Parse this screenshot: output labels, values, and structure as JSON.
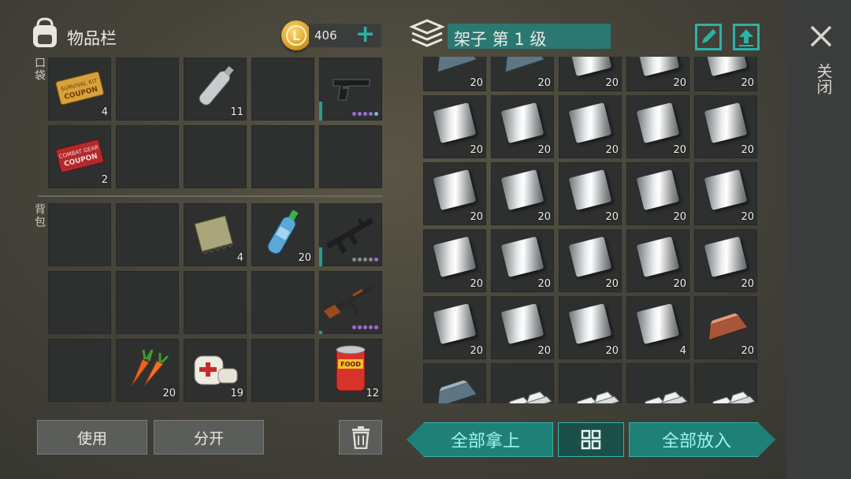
{
  "inventory": {
    "title": "物品栏",
    "coins": "406",
    "add_symbol": "+",
    "pocket_label": "口袋",
    "backpack_label": "背包",
    "pocket": [
      {
        "icon": "coupon-gold-icon",
        "count": "4"
      },
      {
        "icon": "",
        "count": ""
      },
      {
        "icon": "water-bottle-empty-icon",
        "count": "11"
      },
      {
        "icon": "",
        "count": ""
      },
      {
        "icon": "pistol-icon",
        "count": "",
        "weapon": true,
        "dots": [
          "#9b6bd9",
          "#9b6bd9",
          "#9b6bd9",
          "#9b6bd9",
          "#8fb3c9"
        ],
        "bar": 0.3
      },
      {
        "icon": "coupon-red-icon",
        "count": "2"
      },
      {
        "icon": "",
        "count": ""
      },
      {
        "icon": "",
        "count": ""
      },
      {
        "icon": "",
        "count": ""
      },
      {
        "icon": "",
        "count": ""
      }
    ],
    "backpack": [
      {
        "icon": "",
        "count": ""
      },
      {
        "icon": "",
        "count": ""
      },
      {
        "icon": "cloth-icon",
        "count": "4"
      },
      {
        "icon": "water-bottle-icon",
        "count": "20"
      },
      {
        "icon": "m16-rifle-icon",
        "count": "",
        "weapon": true,
        "dots": [
          "#8a8a8a",
          "#8a8a8a",
          "#8a8a8a",
          "#8a8a8a",
          "#9b6bd9"
        ],
        "bar": 0.3
      },
      {
        "icon": "",
        "count": ""
      },
      {
        "icon": "",
        "count": ""
      },
      {
        "icon": "",
        "count": ""
      },
      {
        "icon": "",
        "count": ""
      },
      {
        "icon": "ak47-rifle-icon",
        "count": "",
        "weapon": true,
        "dots": [
          "#9b6bd9",
          "#9b6bd9",
          "#9b6bd9",
          "#9b6bd9",
          "#9b6bd9"
        ],
        "bar": 0.05
      },
      {
        "icon": "",
        "count": ""
      },
      {
        "icon": "carrot-icon",
        "count": "20"
      },
      {
        "icon": "bandage-icon",
        "count": "19"
      },
      {
        "icon": "",
        "count": ""
      },
      {
        "icon": "canned-food-icon",
        "count": "12"
      }
    ],
    "use_button": "使用",
    "split_button": "分开"
  },
  "storage": {
    "title": "架子 第 1 级",
    "rows": [
      [
        {
          "icon": "iron-ingot-icon",
          "count": "20"
        },
        {
          "icon": "iron-ingot-icon",
          "count": "20"
        },
        {
          "icon": "steel-plate-icon",
          "count": "20"
        },
        {
          "icon": "steel-plate-icon",
          "count": "20"
        },
        {
          "icon": "steel-plate-icon",
          "count": "20"
        }
      ],
      [
        {
          "icon": "steel-plate-icon",
          "count": "20"
        },
        {
          "icon": "steel-plate-icon",
          "count": "20"
        },
        {
          "icon": "steel-plate-icon",
          "count": "20"
        },
        {
          "icon": "steel-plate-icon",
          "count": "20"
        },
        {
          "icon": "steel-plate-icon",
          "count": "20"
        }
      ],
      [
        {
          "icon": "steel-plate-icon",
          "count": "20"
        },
        {
          "icon": "steel-plate-icon",
          "count": "20"
        },
        {
          "icon": "steel-plate-icon",
          "count": "20"
        },
        {
          "icon": "steel-plate-icon",
          "count": "20"
        },
        {
          "icon": "steel-plate-icon",
          "count": "20"
        }
      ],
      [
        {
          "icon": "steel-plate-icon",
          "count": "20"
        },
        {
          "icon": "steel-plate-icon",
          "count": "20"
        },
        {
          "icon": "steel-plate-icon",
          "count": "20"
        },
        {
          "icon": "steel-plate-icon",
          "count": "20"
        },
        {
          "icon": "steel-plate-icon",
          "count": "20"
        }
      ],
      [
        {
          "icon": "steel-plate-icon",
          "count": "20"
        },
        {
          "icon": "steel-plate-icon",
          "count": "20"
        },
        {
          "icon": "steel-plate-icon",
          "count": "20"
        },
        {
          "icon": "steel-plate-icon",
          "count": "4"
        },
        {
          "icon": "copper-ingot-icon",
          "count": "20"
        }
      ],
      [
        {
          "icon": "iron-ingot-icon",
          "count": ""
        },
        {
          "icon": "silver-bars-icon",
          "count": ""
        },
        {
          "icon": "silver-bars-icon",
          "count": ""
        },
        {
          "icon": "silver-bars-icon",
          "count": ""
        },
        {
          "icon": "silver-bars-icon",
          "count": ""
        }
      ]
    ],
    "take_all": "全部拿上",
    "put_all": "全部放入"
  },
  "close_label": "关闭",
  "colors": {
    "accent": "#1f8077",
    "accent_text": "#9ef4ea",
    "teal_icon": "#2ab3a6"
  }
}
